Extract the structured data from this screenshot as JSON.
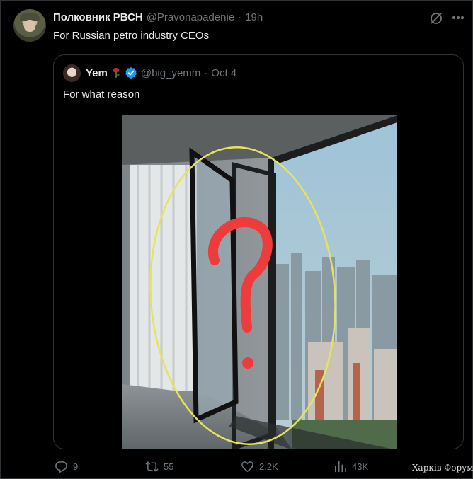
{
  "tweet": {
    "author_name": "Полковник РВСН",
    "handle": "@Pravonapadenie",
    "separator": "·",
    "time": "19h",
    "text": "For Russian petro industry CEOs"
  },
  "quoted": {
    "author_name": "Yem",
    "handle": "@big_yemm",
    "separator": "·",
    "date": "Oct 4",
    "text": "For what reason"
  },
  "actions": {
    "replies": "9",
    "reposts": "55",
    "likes": "2.2K",
    "views": "43K"
  },
  "watermark": "Харків Форум",
  "colors": {
    "background": "#000000",
    "text": "#e7e9ea",
    "muted": "#71767b",
    "border": "#2f3336",
    "verified": "#1d9bf0",
    "annotation_circle": "#e8e35a",
    "annotation_question": "#ee3b3b"
  }
}
